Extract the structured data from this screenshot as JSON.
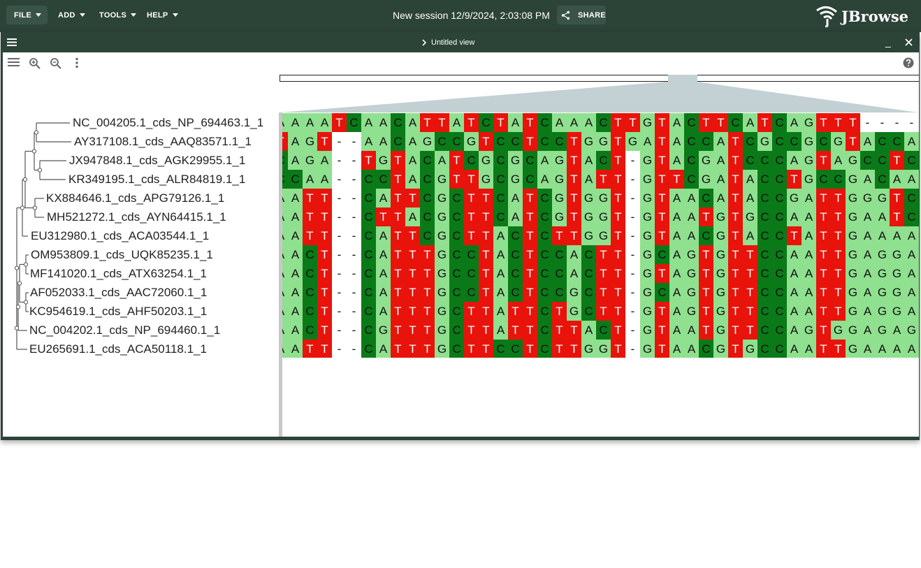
{
  "menus": [
    "FILE",
    "ADD",
    "TOOLS",
    "HELP"
  ],
  "session_title": "New session 12/9/2024, 2:03:08 PM",
  "share_label": "SHARE",
  "brand": "JBrowse",
  "view": {
    "title": "Untitled view",
    "minimize_label": "_"
  },
  "leaves": [
    "NC_004205.1_cds_NP_694463.1_1",
    "AY317108.1_cds_AAQ83571.1_1",
    "JX947848.1_cds_AGK29955.1_1",
    "KR349195.1_cds_ALR84819.1_1",
    "KX884646.1_cds_APG79126.1_1",
    "MH521272.1_cds_AYN64415.1_1",
    "EU312980.1_cds_ACA03544.1_1",
    "OM953809.1_cds_UQK85235.1_1",
    "MF141020.1_cds_ATX63254.1_1",
    "AF052033.1_cds_AAC72060.1_1",
    "KC954619.1_cds_AHF50203.1_1",
    "NC_004202.1_cds_NP_694460.1_1",
    "EU265691.1_cds_ACA50118.1_1"
  ],
  "alignment": [
    "AAAATCAACATTATCTATCAAACTTGTACTTCATCAGTTT----",
    "TAGT--AACAGCCGTCCTCCTGGTGATACCATCGCCGCGTACCA",
    "CAGA--TGTACATCGCGCAGTACT-GTACGATCCCAGTAGCCTC",
    "CCAA--CCTACGTTGCGCAGTATT-GTTCGATACCTGCCGACAA",
    "AATT--CATTCGCTTCATCGTGGT-GTAACATACCGATTGGGTC",
    "AATT--CTTACGCTTCATCGTGGT-GTAATGTGCCAATTGAATC",
    "AATT--CATTCGCTTACTCTTGGT-GTAACGTACCTATTGAAAA",
    "AACT--CATTTGCCTACTCCACTT-GCAGTGTTCCAATTGAGGA",
    "AACT--CATTTGCCTACTCCACTT-GTAGTGTTCCAATTGAGGA",
    "AACT--CATTTGCCTACTCCGCTT-GCAGTGTTCCAATTGAGGA",
    "AACT--CATTTGCTTATTCTGCTT-GTAGTGTTCCAATTGAGGA",
    "AACT--CGTTTGCTTATTCTTACT-GTAATGTTCCAGTGGAGAG",
    "AATT--CATTTGCTTCCTCTTGGT-GTAACGTGCCAATTGAAAA"
  ],
  "colors": {
    "app_bar": "#2c4338",
    "A": "#8fe08f",
    "C": "#0a7a18",
    "G": "#8fe08f",
    "T": "#e8130b"
  },
  "icons": [
    "menu-icon",
    "zoom-in-icon",
    "zoom-out-icon",
    "more-vert-icon",
    "help-icon",
    "share-icon",
    "close-icon",
    "chevron-right-icon"
  ]
}
